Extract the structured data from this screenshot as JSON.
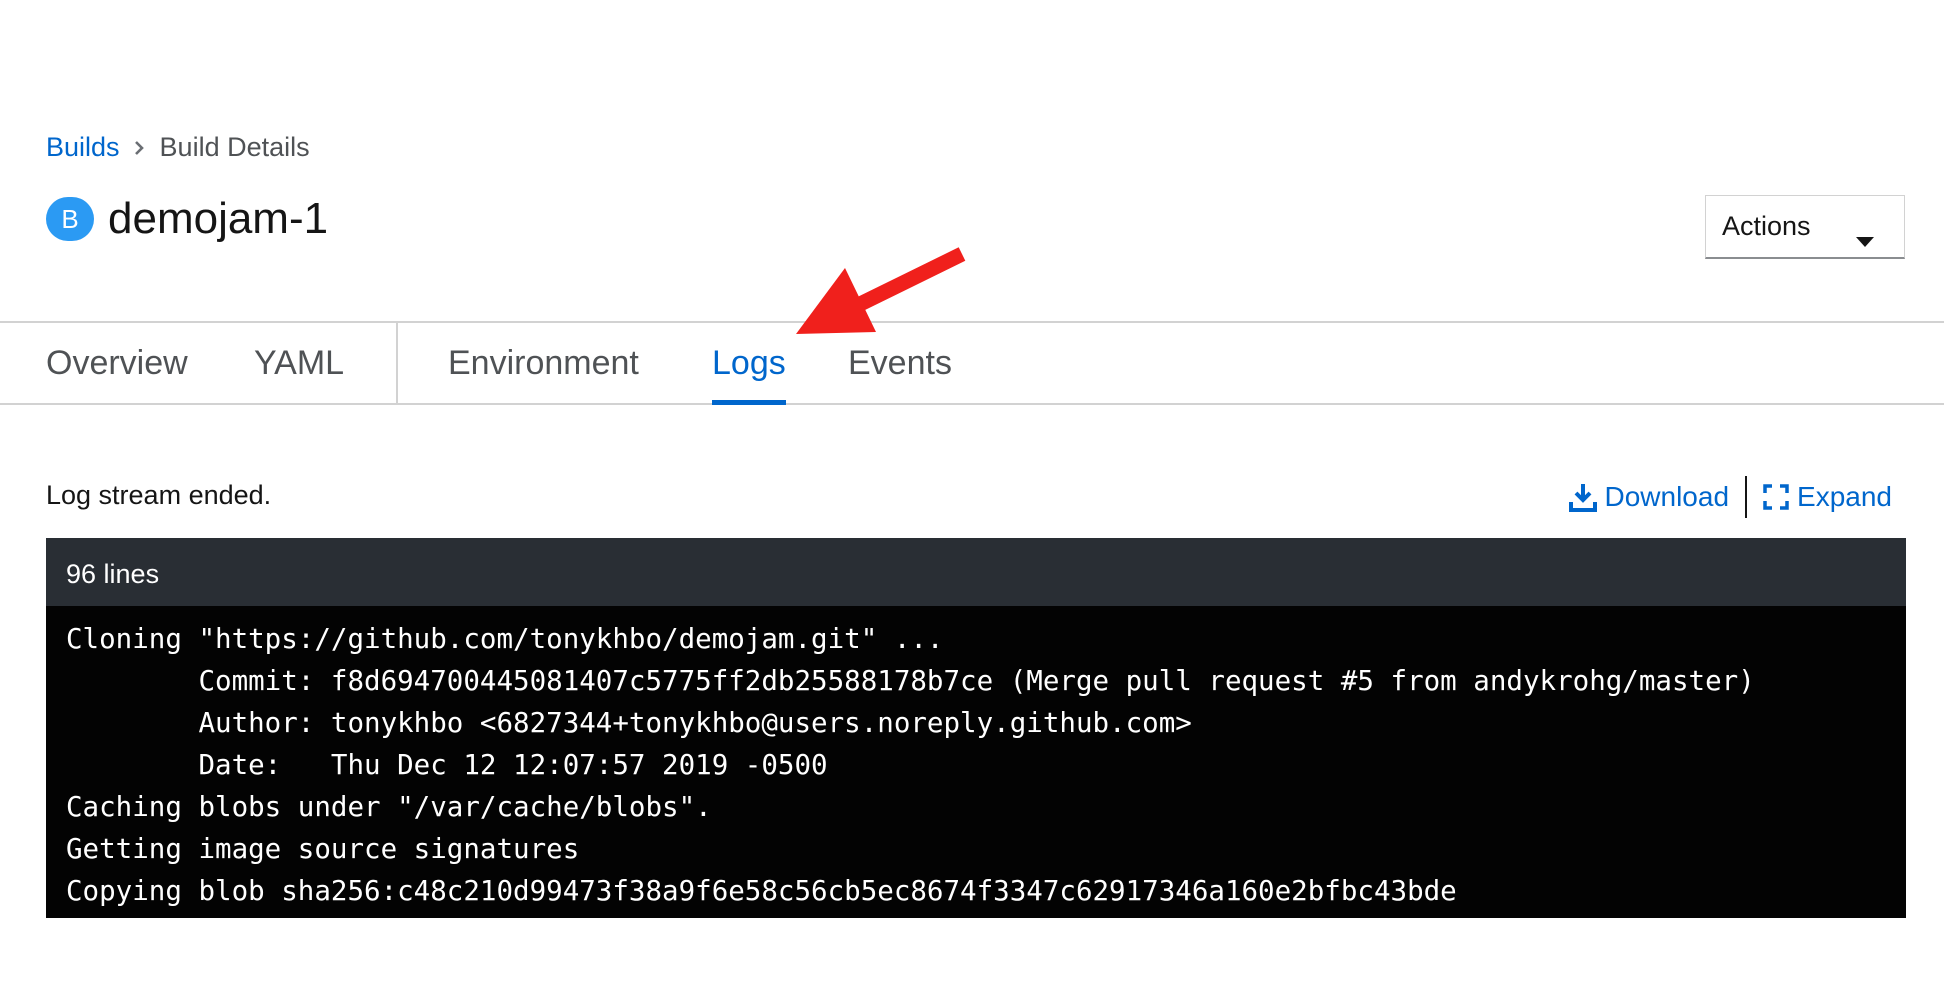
{
  "breadcrumb": {
    "parent": "Builds",
    "current": "Build Details"
  },
  "resource": {
    "badge": "B",
    "name": "demojam-1"
  },
  "actions": {
    "label": "Actions"
  },
  "tabs": [
    {
      "label": "Overview",
      "active": false
    },
    {
      "label": "YAML",
      "active": false
    },
    {
      "label": "Environment",
      "active": false
    },
    {
      "label": "Logs",
      "active": true
    },
    {
      "label": "Events",
      "active": false
    }
  ],
  "log": {
    "status": "Log stream ended.",
    "download_label": "Download",
    "expand_label": "Expand",
    "line_count": "96 lines",
    "lines": [
      "Cloning \"https://github.com/tonykhbo/demojam.git\" ...",
      "        Commit: f8d694700445081407c5775ff2db25588178b7ce (Merge pull request #5 from andykrohg/master)",
      "        Author: tonykhbo <6827344+tonykhbo@users.noreply.github.com>",
      "        Date:   Thu Dec 12 12:07:57 2019 -0500",
      "Caching blobs under \"/var/cache/blobs\".",
      "Getting image source signatures",
      "Copying blob sha256:c48c210d99473f38a9f6e58c56cb5ec8674f3347c62917346a160e2bfbc43bde"
    ]
  },
  "icons": {
    "breadcrumb_separator": "angle-right-icon",
    "actions_caret": "caret-down-icon",
    "download": "download-icon",
    "expand": "expand-icon",
    "annotation": "red-arrow-annotation"
  },
  "colors": {
    "link": "#0066cc",
    "badge": "#2b9af3",
    "log_background": "#030303",
    "log_header": "#292e34",
    "annotation_arrow": "#f0201c"
  }
}
